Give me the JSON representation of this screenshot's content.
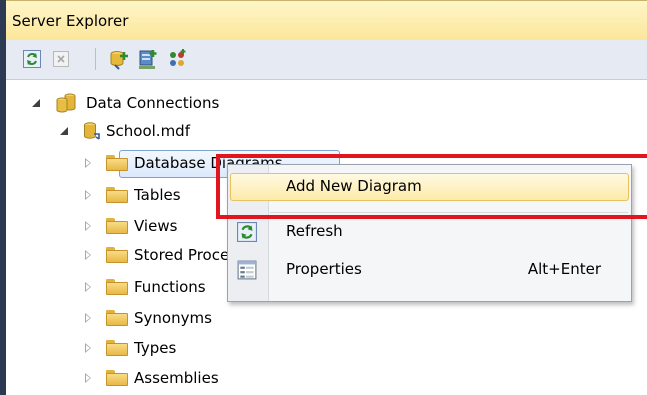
{
  "window": {
    "title": "Server Explorer"
  },
  "toolbar": {
    "buttons": [
      {
        "icon": "refresh-icon"
      },
      {
        "icon": "stop-icon"
      },
      {
        "icon": "connect-to-database-icon"
      },
      {
        "icon": "connect-to-server-icon"
      },
      {
        "icon": "connect-to-sharepoint-icon"
      }
    ]
  },
  "tree": {
    "root": {
      "label": "Data Connections",
      "icon": "data-connections-icon",
      "expanded": true
    },
    "database": {
      "label": "School.mdf",
      "icon": "database-icon",
      "expanded": true
    },
    "nodes": [
      {
        "label": "Database Diagrams",
        "icon": "folder-icon",
        "selected": true
      },
      {
        "label": "Tables",
        "icon": "folder-icon"
      },
      {
        "label": "Views",
        "icon": "folder-icon"
      },
      {
        "label": "Stored Procedures",
        "icon": "folder-icon"
      },
      {
        "label": "Functions",
        "icon": "folder-icon"
      },
      {
        "label": "Synonyms",
        "icon": "folder-icon"
      },
      {
        "label": "Types",
        "icon": "folder-icon"
      },
      {
        "label": "Assemblies",
        "icon": "folder-icon"
      }
    ]
  },
  "context_menu": {
    "items": [
      {
        "label": "Add New Diagram",
        "shortcut": "",
        "icon": "",
        "highlighted": true
      },
      {
        "label": "Refresh",
        "shortcut": "",
        "icon": "refresh-icon"
      },
      {
        "label": "Properties",
        "shortcut": "Alt+Enter",
        "icon": "properties-icon"
      }
    ]
  },
  "annotation": {
    "color": "#e0151d"
  },
  "colors": {
    "title_bar": "#fbe69a",
    "toolbar": "#e6ebf3",
    "menu_highlight": "#fdeaa9",
    "selection": "#dbe9fb"
  }
}
